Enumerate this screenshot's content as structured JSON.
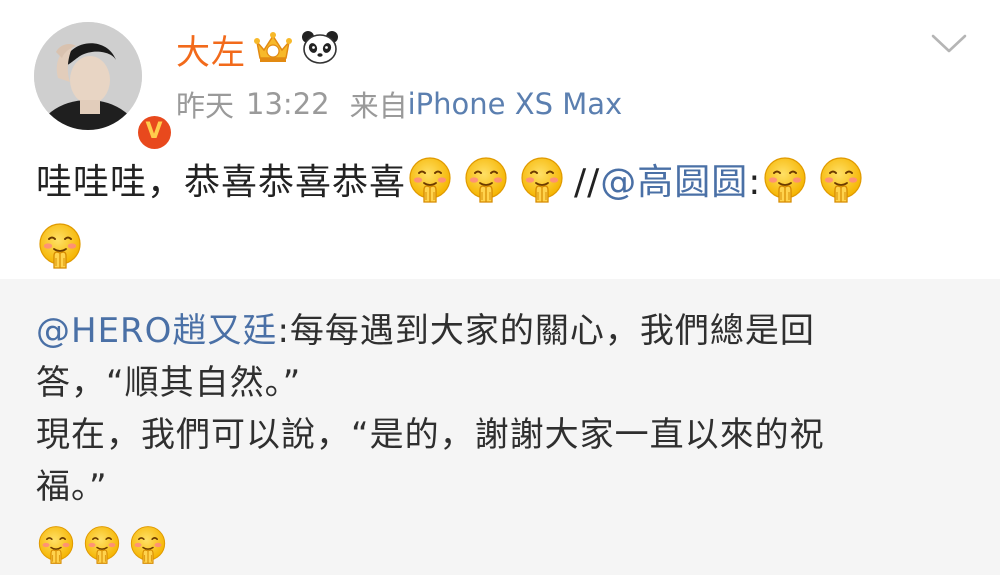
{
  "post": {
    "author": "大左",
    "time_day": "昨天",
    "time_clock": "13:22",
    "source_prefix": "来自",
    "source_device": "iPhone XS Max",
    "text_before": "哇哇哇，恭喜恭喜恭喜",
    "repost_separator": "//",
    "mention": "@高圆圆",
    "mention_colon": ":",
    "emoji_name": "blessing-hands-face-emoji"
  },
  "retweet": {
    "mention": "@HERO趙又廷",
    "line1_rest": ":每每遇到大家的關心，我們總是回",
    "line2": "答，“順其自然。”",
    "line3": "現在，我們可以說，“是的，謝謝大家一直以來的祝",
    "line4": "福。”"
  },
  "badges": {
    "verified_letter": "V"
  },
  "colors": {
    "username": "#f26a1b",
    "link": "#4a70a6",
    "meta": "#9a9a9a",
    "retweet_bg": "#f5f5f5",
    "verified_badge": "#e8491d"
  }
}
